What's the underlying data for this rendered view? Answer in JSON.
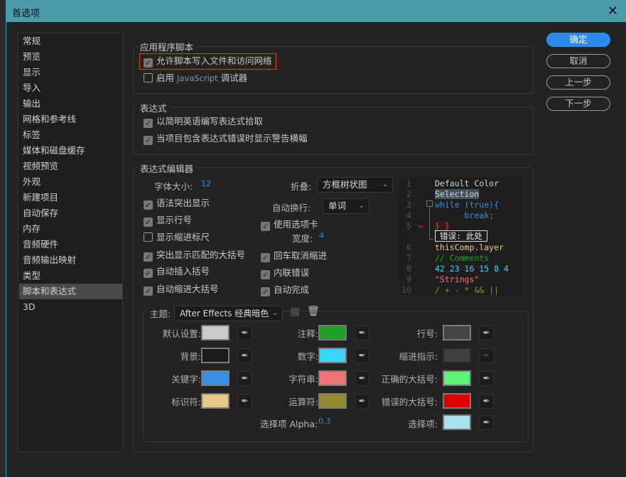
{
  "window": {
    "title": "首选项",
    "close": "✕"
  },
  "sidebar": {
    "items": [
      "常规",
      "预览",
      "显示",
      "导入",
      "输出",
      "网格和参考线",
      "标签",
      "媒体和磁盘缓存",
      "视频预览",
      "外观",
      "新建项目",
      "自动保存",
      "内存",
      "音频硬件",
      "音频输出映射",
      "类型",
      "脚本和表达式",
      "3D"
    ],
    "selected": 16
  },
  "buttons": {
    "ok": "确定",
    "cancel": "取消",
    "prev": "上一步",
    "next": "下一步"
  },
  "app_scripts": {
    "title": "应用程序脚本",
    "allow_write": {
      "label": "允许脚本写入文件和访问网络",
      "checked": true
    },
    "enable_debugger": {
      "label_pre": "启用",
      "label_js": "JavaScript",
      "label_post": "调试器",
      "checked": false
    }
  },
  "expressions": {
    "title": "表达式",
    "plain_english": {
      "label": "以简明英语编写表达式拾取",
      "checked": true
    },
    "warn_banner": {
      "label": "当项目包含表达式错误时显示警告横幅",
      "checked": true
    }
  },
  "editor": {
    "title": "表达式编辑器",
    "font_size_label": "字体大小:",
    "font_size": "12",
    "fold_label": "折叠:",
    "fold_value": "方框树状图",
    "wrap_label": "自动换行:",
    "wrap_value": "单词",
    "use_tabs": {
      "label": "使用选项卡",
      "checked": true
    },
    "tab_width_label": "宽度:",
    "tab_width": "4",
    "left_checks": [
      {
        "label": "语法突出显示",
        "checked": true
      },
      {
        "label": "显示行号",
        "checked": true
      },
      {
        "label": "显示缩进标尺",
        "checked": false
      },
      {
        "label": "突出显示匹配的大括号",
        "checked": true
      },
      {
        "label": "自动插入括号",
        "checked": true
      },
      {
        "label": "自动缩进大括号",
        "checked": true
      }
    ],
    "right_checks": [
      {
        "label": "回车取消缩进",
        "checked": true
      },
      {
        "label": "内联错误",
        "checked": true
      },
      {
        "label": "自动完成",
        "checked": true
      }
    ],
    "preview": {
      "lines": [
        {
          "n": "1",
          "t": "Default Color",
          "c": "#d4d4d4"
        },
        {
          "n": "2",
          "t": "Selection",
          "c": "#d4d4d4"
        },
        {
          "n": "3",
          "t": "while (true){",
          "c": "#3a8ee6"
        },
        {
          "n": "4",
          "t": "      break;",
          "c": "#3a8ee6"
        },
        {
          "n": "5",
          "t": "} }",
          "c": "#c05030"
        },
        {
          "n": "6",
          "t": "thisComp.layer",
          "c": "#e8c98a"
        },
        {
          "n": "7",
          "t": "// Comments",
          "c": "#1f9e2a"
        },
        {
          "n": "8",
          "t": "42 23 16 15 8 4",
          "c": "#3ad4ff"
        },
        {
          "n": "9",
          "t": "\"Strings\"",
          "c": "#f47474"
        },
        {
          "n": "10",
          "t": "/ + - * && ||",
          "c": "#948a30"
        }
      ],
      "error_text": "错误: 此处"
    }
  },
  "theme": {
    "label": "主题:",
    "value": "After Effects 经典暗色",
    "colors": [
      {
        "label": "默认设置:",
        "hex": "#cccccc"
      },
      {
        "label": "注释:",
        "hex": "#1f9e2a"
      },
      {
        "label": "行号:",
        "hex": "#444444"
      },
      {
        "label": "背景:",
        "hex": "#1a1a1a"
      },
      {
        "label": "数字:",
        "hex": "#3ad4ff"
      },
      {
        "label": "缩进指示:",
        "hex": "#404040"
      },
      {
        "label": "关键字:",
        "hex": "#3a8ee6"
      },
      {
        "label": "字符串:",
        "hex": "#f47474"
      },
      {
        "label": "正确的大括号:",
        "hex": "#5cf57a"
      },
      {
        "label": "标识符:",
        "hex": "#e8c98a"
      },
      {
        "label": "运算符:",
        "hex": "#948a30"
      },
      {
        "label": "错误的大括号:",
        "hex": "#e00000"
      }
    ],
    "alpha_label": "选择项 Alpha:",
    "alpha": "0.3",
    "selection_label": "选择项:",
    "selection_hex": "#a8e4f0"
  },
  "accent": "#2d8ceb"
}
